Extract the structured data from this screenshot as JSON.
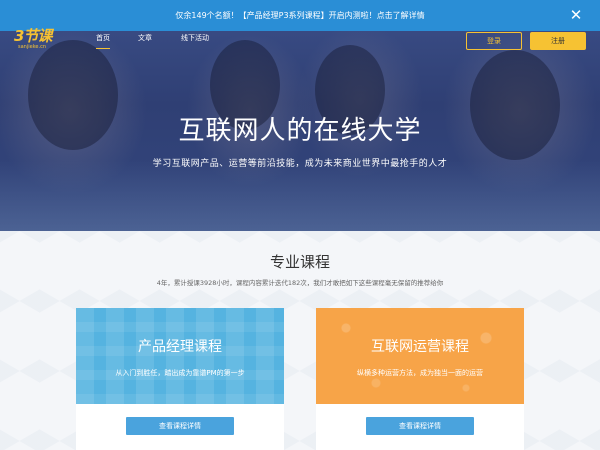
{
  "banner": {
    "text": "仅余149个名额！【产品经理P3系列课程】开启内测啦！点击了解详情",
    "close_icon": "close-icon"
  },
  "nav": {
    "logo_main": "3节课",
    "logo_sub": "sanjieke.cn",
    "links": [
      {
        "label": "首页",
        "active": true
      },
      {
        "label": "文章",
        "active": false
      },
      {
        "label": "线下活动",
        "active": false
      }
    ],
    "login_label": "登录",
    "register_label": "注册"
  },
  "hero": {
    "title": "互联网人的在线大学",
    "subtitle": "学习互联网产品、运营等前沿技能，成为未来商业世界中最抢手的人才"
  },
  "courses": {
    "title": "专业课程",
    "description": "4年，累计授课3928小时，课程内容累计迭代182次，我们才敢把如下这些课程毫无保留的推荐给你",
    "cards": [
      {
        "title": "产品经理课程",
        "desc": "从入门到胜任，踏出成为靠谱PM的第一步",
        "button": "查看课程详情",
        "color": "#55b3e0"
      },
      {
        "title": "互联网运营课程",
        "desc": "纵横多种运营方法，成为独当一面的运营",
        "button": "查看课程详情",
        "color": "#f7a448"
      }
    ]
  },
  "colors": {
    "banner": "#2a8ed6",
    "accent": "#f6c233",
    "button_blue": "#4aa3dd"
  }
}
